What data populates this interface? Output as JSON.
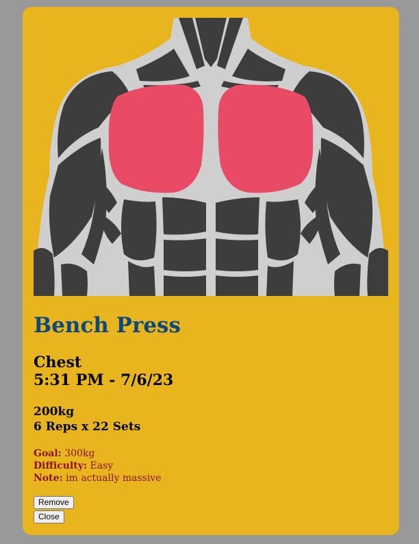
{
  "exercise": {
    "name": "Bench Press",
    "muscle": "Chest",
    "time": "5:31 PM - 7/6/23",
    "weight": "200kg",
    "reps": "6",
    "reps_label": "Reps x",
    "sets": "22",
    "sets_label": "Sets"
  },
  "details": {
    "goal_label": "Goal:",
    "goal_value": "300kg",
    "difficulty_label": "Difficulty:",
    "difficulty_value": "Easy",
    "note_label": "Note:",
    "note_value": "im actually massive"
  },
  "buttons": {
    "remove_label": "Remove",
    "close_label": "Close"
  },
  "illustration": {
    "icon": "torso-muscle-diagram",
    "highlighted_muscle": "chest",
    "highlight_color": "#e94b66",
    "muscle_color": "#3d3d3d",
    "outline_color": "#cfcfcf"
  },
  "colors": {
    "card_background": "#e8b51e",
    "page_background": "#999999",
    "title_color": "#0d4a7a",
    "detail_color": "#8b1010"
  }
}
